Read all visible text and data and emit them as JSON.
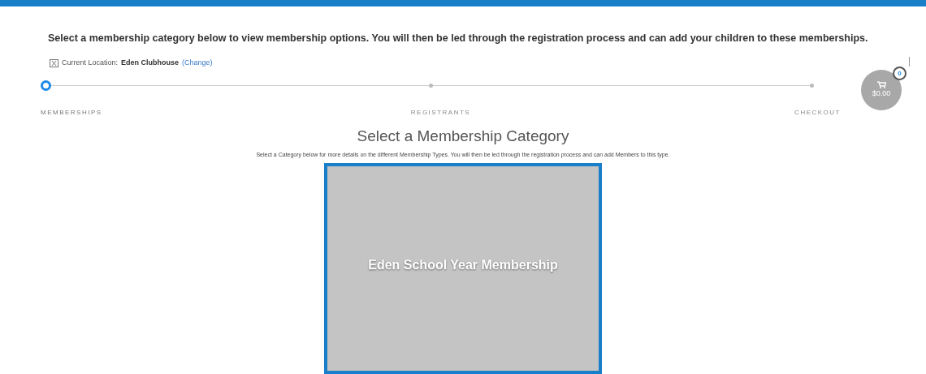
{
  "intro": "Select a membership category below to view membership options. You will then be led through the registration process and can add your children to these memberships.",
  "location": {
    "label": "Current Location:",
    "name": "Eden Clubhouse",
    "change": "(Change)"
  },
  "steps": [
    {
      "label": "MEMBERSHIPS",
      "selected": true
    },
    {
      "label": "REGISTRANTS",
      "selected": false
    },
    {
      "label": "CHECKOUT",
      "selected": false
    }
  ],
  "cart": {
    "count": "0",
    "total": "$0.00"
  },
  "heading": "Select a Membership Category",
  "subheading": "Select a Category below for more details on the different Membership Types. You will then be led through the registration process and can add Members to this type.",
  "categories": [
    {
      "title": "Eden School Year Membership",
      "selected": true
    }
  ]
}
